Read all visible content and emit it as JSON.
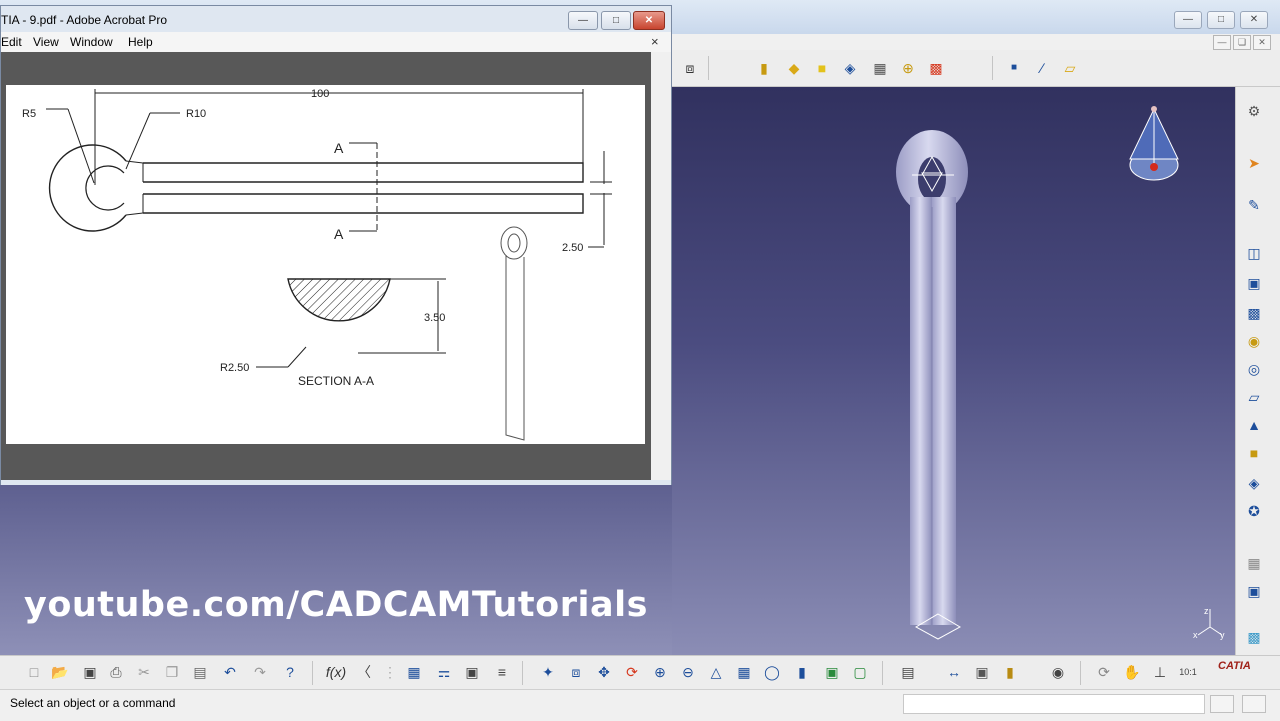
{
  "acrobat": {
    "title": "TIA - 9.pdf - Adobe Acrobat Pro",
    "menu": [
      "Edit",
      "View",
      "Window",
      "Help"
    ],
    "doc_close": "×"
  },
  "drawing": {
    "dim_length": "100",
    "radius_small": "R5",
    "radius_large": "R10",
    "section_marker": "A",
    "dim_width": "2.50",
    "dim_section_height": "3.50",
    "section_radius": "R2.50",
    "section_label": "SECTION A-A"
  },
  "watermark": "youtube.com/CADCAMTutorials",
  "status_bar": {
    "message": "Select an object or a command"
  },
  "compass": {
    "x": "x",
    "y": "y",
    "z": "z"
  },
  "catia_logo": "CATIA",
  "colors": {
    "viewport_top": "#31315f",
    "viewport_bottom": "#8b8db5",
    "part_color": "#c9cae4",
    "accent_blue": "#1d4e9b"
  },
  "top_toolbar_icons": [
    "fit-all-icon",
    "sketch-pad-icon",
    "pocket-icon",
    "pad-icon",
    "shaft-icon",
    "multi-section-icon",
    "point-icon",
    "line-icon",
    "plane-icon"
  ],
  "right_toolbar_icons": [
    "settings-icon",
    "select-arrow-icon",
    "sketcher-icon",
    "pad-icon",
    "pocket-icon",
    "shaft-icon",
    "groove-icon",
    "hole-icon",
    "rib-icon",
    "slot-icon",
    "solid-combine-icon",
    "multisection-solid-icon",
    "removed-multisection-icon",
    "boolean-icon",
    "axis-system-icon",
    "material-icon"
  ],
  "bottom_toolbar_icons": [
    "new-icon",
    "open-icon",
    "save-icon",
    "print-icon",
    "cut-icon",
    "copy-icon",
    "paste-icon",
    "undo-icon",
    "redo-icon",
    "whats-this-icon",
    "formula-icon",
    "comment-icon",
    "knowledge-icon",
    "table-icon",
    "tree-icon",
    "lock-icon",
    "measure-icon",
    "fly-icon",
    "fit-all-icon",
    "pan-icon",
    "rotate-icon",
    "zoom-in-icon",
    "zoom-out-icon",
    "normal-view-icon",
    "multi-view-icon",
    "iso-view-icon",
    "shading-icon",
    "hide-show-icon",
    "swap-icon",
    "measure-between-icon",
    "measure-item-icon",
    "mass-icon",
    "capture-icon",
    "update-icon",
    "rotate-mode-icon",
    "compass-icon",
    "ratio-icon",
    "catia-logo"
  ]
}
